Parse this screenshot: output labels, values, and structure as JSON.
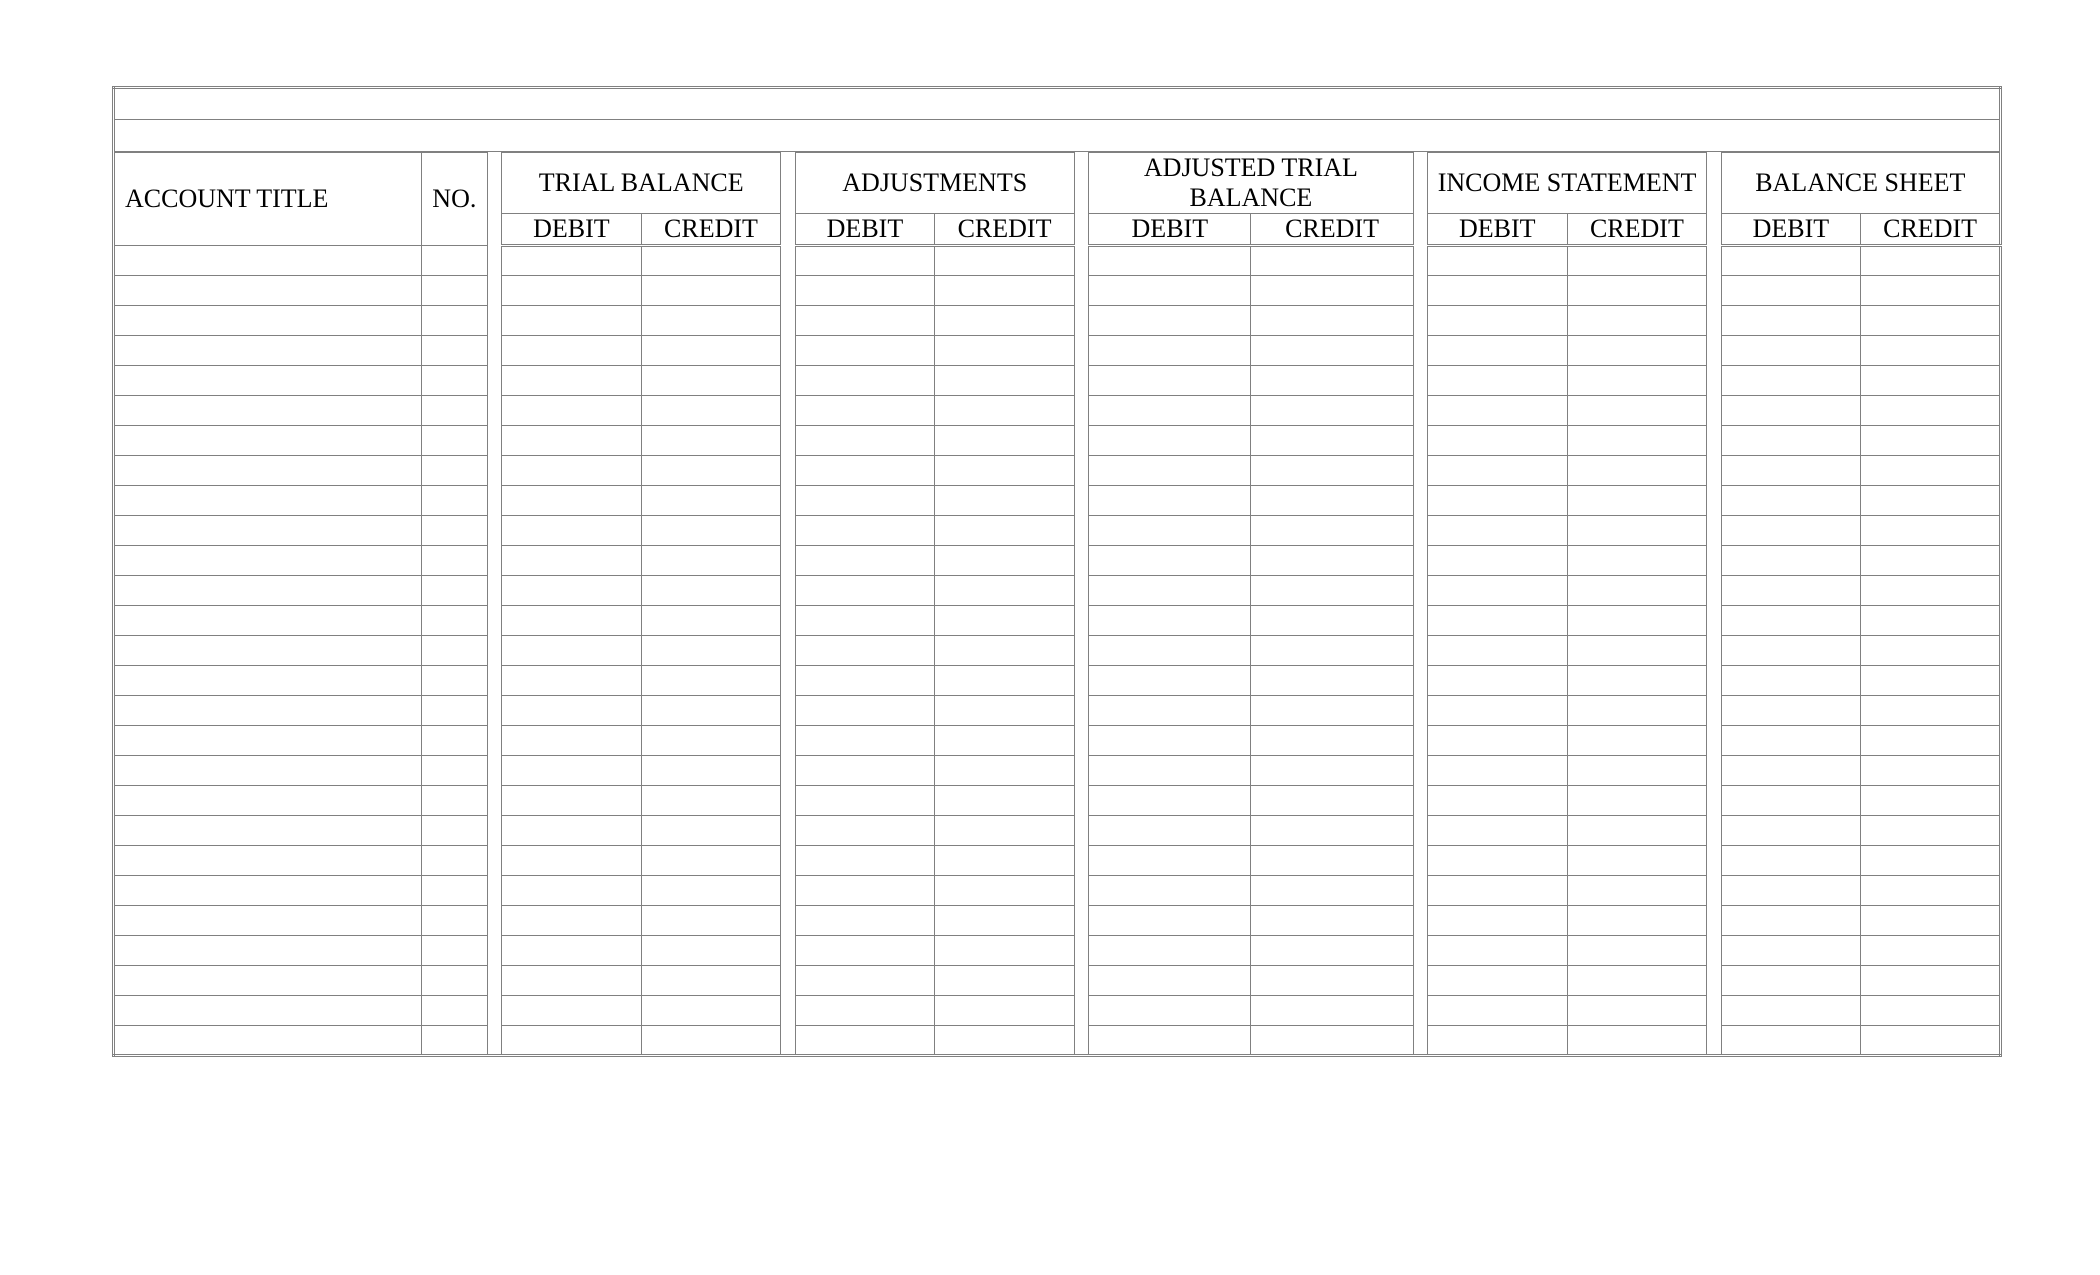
{
  "headers": {
    "account_title": "ACCOUNT TITLE",
    "no": "NO.",
    "trial_balance": "TRIAL BALANCE",
    "adjustments": "ADJUSTMENTS",
    "adjusted_trial_balance": "ADJUSTED TRIAL BALANCE",
    "income_statement": "INCOME STATEMENT",
    "balance_sheet": "BALANCE SHEET",
    "debit": "DEBIT",
    "credit": "CREDIT"
  },
  "blank_rows": 27,
  "rows": []
}
